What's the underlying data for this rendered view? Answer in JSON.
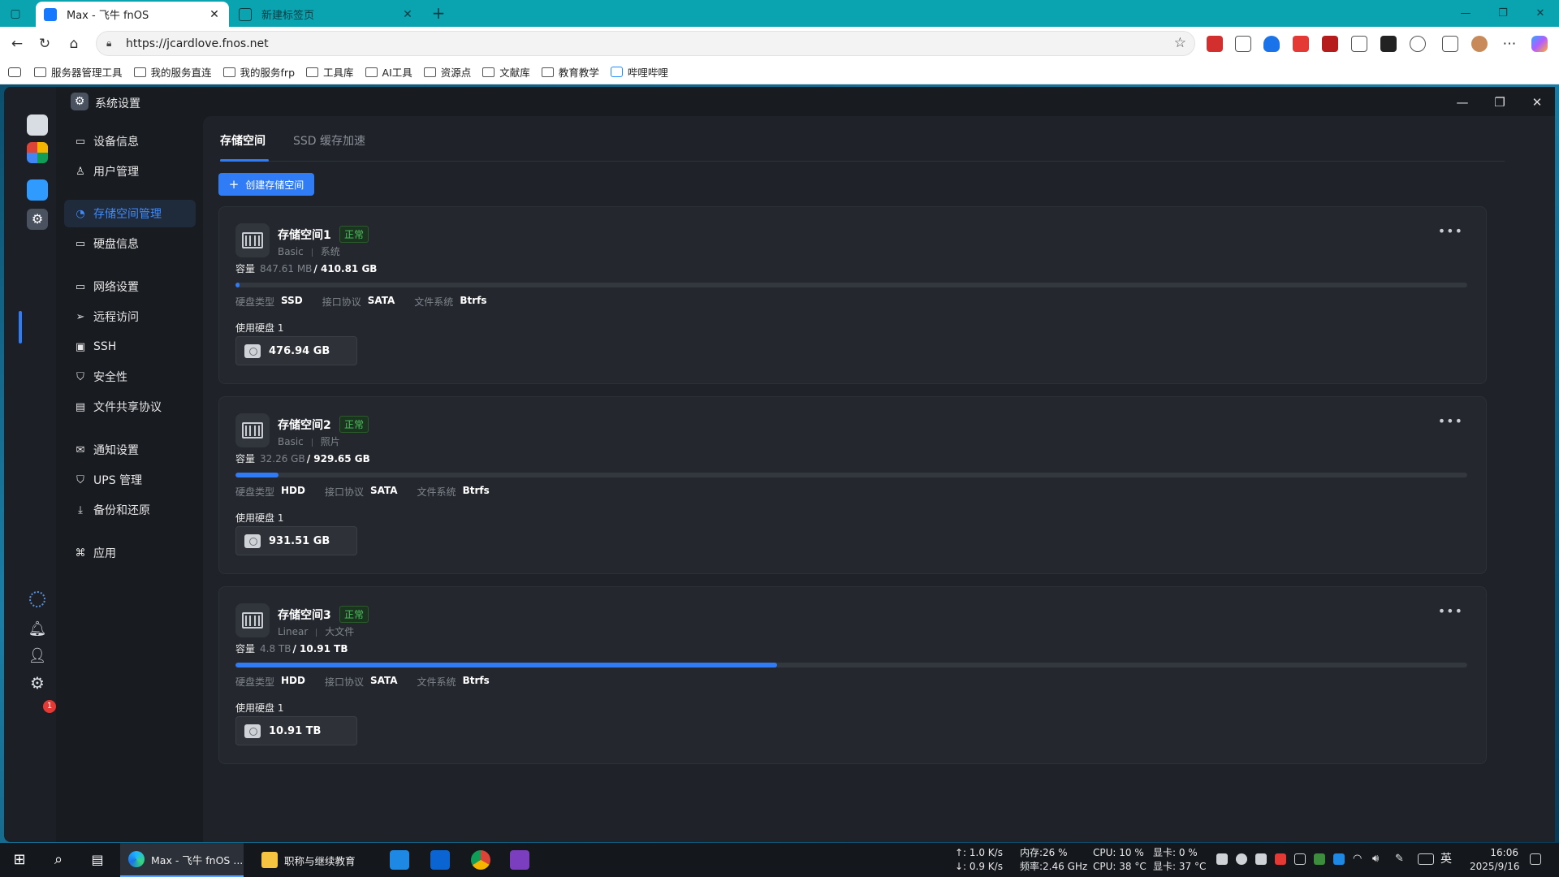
{
  "browser": {
    "tabs": [
      {
        "title": "Max - 飞牛 fnOS",
        "active": true
      },
      {
        "title": "新建标签页",
        "active": false
      }
    ],
    "url": "https://jcardlove.fnos.net",
    "bookmarks": [
      "服务器管理工具",
      "我的服务直连",
      "我的服务frp",
      "工具库",
      "AI工具",
      "资源点",
      "文献库",
      "教育教学",
      "哔哩哔哩"
    ]
  },
  "window": {
    "title": "系统设置"
  },
  "sidebar": {
    "items": [
      {
        "label": "设备信息",
        "icon": "monitor-icon"
      },
      {
        "label": "用户管理",
        "icon": "user-icon"
      },
      {
        "label": "存储空间管理",
        "icon": "storage-icon",
        "active": true
      },
      {
        "label": "硬盘信息",
        "icon": "disk-icon"
      },
      {
        "label": "网络设置",
        "icon": "network-icon"
      },
      {
        "label": "远程访问",
        "icon": "send-icon"
      },
      {
        "label": "SSH",
        "icon": "terminal-icon"
      },
      {
        "label": "安全性",
        "icon": "shield-icon"
      },
      {
        "label": "文件共享协议",
        "icon": "file-icon"
      },
      {
        "label": "通知设置",
        "icon": "mail-icon"
      },
      {
        "label": "UPS 管理",
        "icon": "ups-shield-icon"
      },
      {
        "label": "备份和还原",
        "icon": "backup-icon"
      },
      {
        "label": "应用",
        "icon": "apps-icon"
      }
    ]
  },
  "content": {
    "tabs": [
      {
        "label": "存储空间",
        "active": true
      },
      {
        "label": "SSD 缓存加速",
        "active": false
      }
    ],
    "create_button": "创建存储空间",
    "pools": [
      {
        "name": "存储空间1",
        "status": "正常",
        "raid": "Basic",
        "tag": "系统",
        "cap_label": "容量",
        "used": "847.61 MB",
        "total": "/ 410.81 GB",
        "usage_fraction": 0.002,
        "props": [
          {
            "k": "硬盘类型",
            "v": "SSD"
          },
          {
            "k": "接口协议",
            "v": "SATA"
          },
          {
            "k": "文件系统",
            "v": "Btrfs"
          }
        ],
        "disks_label": "使用硬盘 1",
        "disk_size": "476.94 GB"
      },
      {
        "name": "存储空间2",
        "status": "正常",
        "raid": "Basic",
        "tag": "照片",
        "cap_label": "容量",
        "used": "32.26 GB",
        "total": "/ 929.65 GB",
        "usage_fraction": 0.035,
        "props": [
          {
            "k": "硬盘类型",
            "v": "HDD"
          },
          {
            "k": "接口协议",
            "v": "SATA"
          },
          {
            "k": "文件系统",
            "v": "Btrfs"
          }
        ],
        "disks_label": "使用硬盘 1",
        "disk_size": "931.51 GB"
      },
      {
        "name": "存储空间3",
        "status": "正常",
        "raid": "Linear",
        "tag": "大文件",
        "cap_label": "容量",
        "used": "4.8 TB",
        "total": "/ 10.91 TB",
        "usage_fraction": 0.44,
        "props": [
          {
            "k": "硬盘类型",
            "v": "HDD"
          },
          {
            "k": "接口协议",
            "v": "SATA"
          },
          {
            "k": "文件系统",
            "v": "Btrfs"
          }
        ],
        "disks_label": "使用硬盘 1",
        "disk_size": "10.91 TB"
      }
    ]
  },
  "dock": {
    "notification_count": "1"
  },
  "taskbar": {
    "apps": [
      {
        "label": "Max - 飞牛 fnOS ...",
        "active": true
      },
      {
        "label": "职称与继续教育",
        "active": false
      }
    ],
    "net_up": "↑: 1.0 K/s",
    "net_down": "↓: 0.9 K/s",
    "mem": "内存:26 %",
    "freq": "频率:2.46 GHz",
    "cpu_load": "CPU: 10 %",
    "cpu_temp": "CPU: 38 °C",
    "gpu_load": "显卡: 0 %",
    "gpu_temp": "显卡: 37 °C",
    "ime": "英",
    "time": "16:06",
    "date": "2025/9/16"
  },
  "colors": {
    "accent": "#2f7cf6",
    "status_ok": "#4cc15d",
    "chrome_teal": "#0aa3b0"
  }
}
